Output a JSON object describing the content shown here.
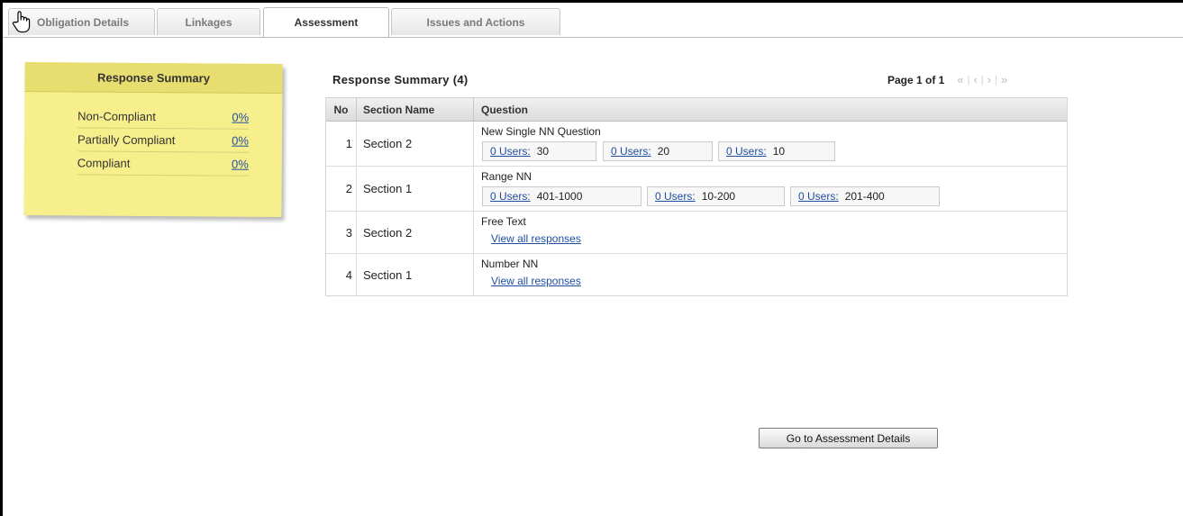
{
  "tabs": [
    {
      "label": "Obligation Details"
    },
    {
      "label": "Linkages"
    },
    {
      "label": "Assessment"
    },
    {
      "label": "Issues and Actions"
    }
  ],
  "sticky": {
    "title": "Response Summary",
    "rows": [
      {
        "label": "Non-Compliant",
        "value": "0%"
      },
      {
        "label": "Partially Compliant",
        "value": "0%"
      },
      {
        "label": "Compliant",
        "value": "0%"
      }
    ]
  },
  "summary": {
    "title": "Response Summary (4)",
    "page_label": "Page 1 of 1",
    "columns": [
      "No",
      "Section Name",
      "Question"
    ],
    "rows": [
      {
        "no": "1",
        "section": "Section 2",
        "question": "New Single NN Question",
        "responses": [
          {
            "users": "0 Users:",
            "value": "30"
          },
          {
            "users": "0 Users:",
            "value": "20"
          },
          {
            "users": "0 Users:",
            "value": "10"
          }
        ]
      },
      {
        "no": "2",
        "section": "Section 1",
        "question": "Range NN",
        "responses": [
          {
            "users": "0 Users:",
            "value": "401-1000"
          },
          {
            "users": "0 Users:",
            "value": "10-200"
          },
          {
            "users": "0 Users:",
            "value": "201-400"
          }
        ]
      },
      {
        "no": "3",
        "section": "Section 2",
        "question": "Free Text",
        "link": "View all responses"
      },
      {
        "no": "4",
        "section": "Section 1",
        "question": "Number NN",
        "link": "View all responses"
      }
    ]
  },
  "go_button": "Go to Assessment Details"
}
